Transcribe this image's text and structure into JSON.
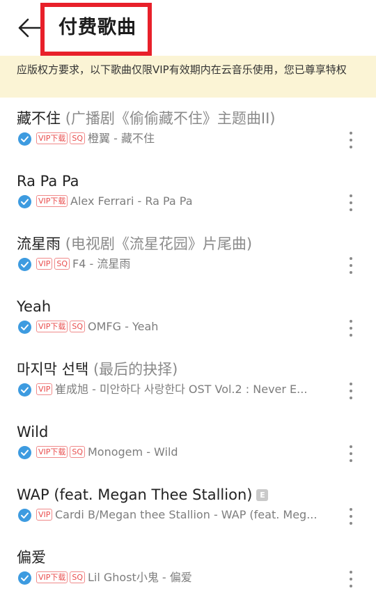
{
  "header": {
    "title": "付费歌曲"
  },
  "notice": {
    "text": "应版权方要求，以下歌曲仅限VIP有效期内在云音乐使用，您已尊享特权"
  },
  "songs": [
    {
      "title": "藏不住",
      "subtitle": "(广播剧《偷偷藏不住》主题曲II)",
      "explicit": false,
      "badges": [
        "VIP下载",
        "SQ"
      ],
      "artist": "橙翼 - 藏不住"
    },
    {
      "title": "Ra Pa Pa",
      "subtitle": "",
      "explicit": false,
      "badges": [
        "VIP下载"
      ],
      "artist": "Alex Ferrari - Ra Pa Pa"
    },
    {
      "title": "流星雨",
      "subtitle": "(电视剧《流星花园》片尾曲)",
      "explicit": false,
      "badges": [
        "VIP",
        "SQ"
      ],
      "artist": "F4 - 流星雨"
    },
    {
      "title": "Yeah",
      "subtitle": "",
      "explicit": false,
      "badges": [
        "VIP下载",
        "SQ"
      ],
      "artist": "OMFG - Yeah"
    },
    {
      "title": "마지막 선택",
      "subtitle": "(最后的抉择)",
      "explicit": false,
      "badges": [
        "VIP"
      ],
      "artist": "崔成旭 - 미안하다 사랑한다 OST   Vol.2 : Never E..."
    },
    {
      "title": "Wild",
      "subtitle": "",
      "explicit": false,
      "badges": [
        "VIP下载",
        "SQ"
      ],
      "artist": "Monogem - Wild"
    },
    {
      "title": "WAP (feat. Megan Thee Stallion)",
      "subtitle": "",
      "explicit": true,
      "explicit_label": "E",
      "badges": [
        "VIP"
      ],
      "artist": "Cardi B/Megan thee Stallion - WAP (feat. Meg..."
    },
    {
      "title": "偏爱",
      "subtitle": "",
      "explicit": false,
      "badges": [
        "VIP下载",
        "SQ"
      ],
      "artist": "Lil Ghost小鬼 - 偏爱"
    }
  ],
  "icons": {
    "back": "arrow-left-icon",
    "verified": "check-circle-icon",
    "more": "more-vertical-icon"
  },
  "colors": {
    "highlight_box": "#e8202a",
    "notice_bg": "#fbf4d5",
    "badge": "#e94d4d",
    "verified": "#3d9be0"
  }
}
